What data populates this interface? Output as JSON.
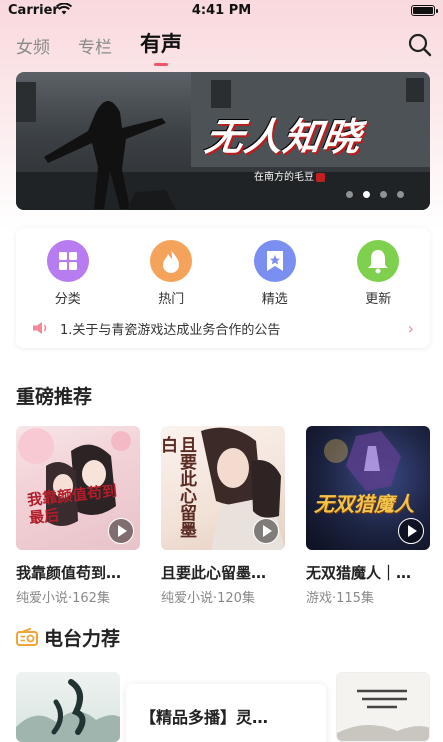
{
  "status_bar": {
    "carrier": "Carrier",
    "time": "4:41 PM"
  },
  "tabs": [
    {
      "label": "女频",
      "active": false
    },
    {
      "label": "专栏",
      "active": false
    },
    {
      "label": "有声",
      "active": true
    }
  ],
  "banner": {
    "title": "无人知晓",
    "author": "在南方的毛豆",
    "active_dot": 1,
    "dot_count": 4
  },
  "categories": [
    {
      "label": "分类",
      "icon": "grid-icon",
      "color": "#b67cf0"
    },
    {
      "label": "热门",
      "icon": "flame-icon",
      "color": "#f5a25b"
    },
    {
      "label": "精选",
      "icon": "bookmark-star-icon",
      "color": "#7b8ff0"
    },
    {
      "label": "更新",
      "icon": "bell-icon",
      "color": "#7ed04e"
    }
  ],
  "notice": {
    "text": "1.关于与青瓷游戏达成业务合作的公告"
  },
  "sections": {
    "featured_title": "重磅推荐",
    "radio_title": "电台力荐"
  },
  "books": [
    {
      "title": "我靠颜值苟到…",
      "meta": "纯爱小说·162集",
      "cover_text": "我靠颜值苟到最后"
    },
    {
      "title": "且要此心留墨…",
      "meta": "纯爱小说·120集",
      "cover_text": "且要此心留墨白"
    },
    {
      "title": "无双猎魔人｜…",
      "meta": "游戏·115集",
      "cover_text": "无双猎魔人"
    }
  ],
  "radio": {
    "featured_title": "【精品多播】灵…"
  }
}
